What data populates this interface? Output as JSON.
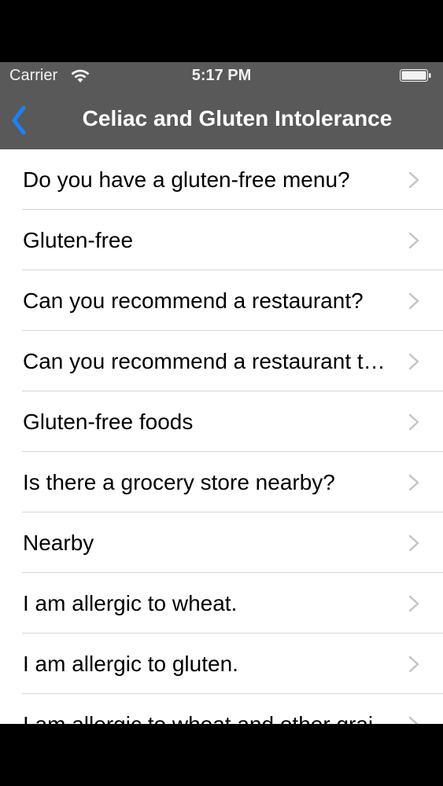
{
  "status_bar": {
    "carrier": "Carrier",
    "time": "5:17 PM"
  },
  "nav": {
    "title": "Celiac and Gluten Intolerance",
    "back_icon": "chevron-left-icon",
    "accent_color": "#1a82fb"
  },
  "list": {
    "items": [
      {
        "label": "Do you have a gluten-free menu?"
      },
      {
        "label": "Gluten-free"
      },
      {
        "label": "Can you recommend a restaurant?"
      },
      {
        "label": "Can you recommend a restaurant that serves gluten-free food?"
      },
      {
        "label": "Gluten-free foods"
      },
      {
        "label": "Is there a grocery store nearby?"
      },
      {
        "label": "Nearby"
      },
      {
        "label": "I am allergic to wheat."
      },
      {
        "label": "I am allergic to gluten."
      },
      {
        "label": "I am allergic to wheat and other grains."
      }
    ]
  }
}
